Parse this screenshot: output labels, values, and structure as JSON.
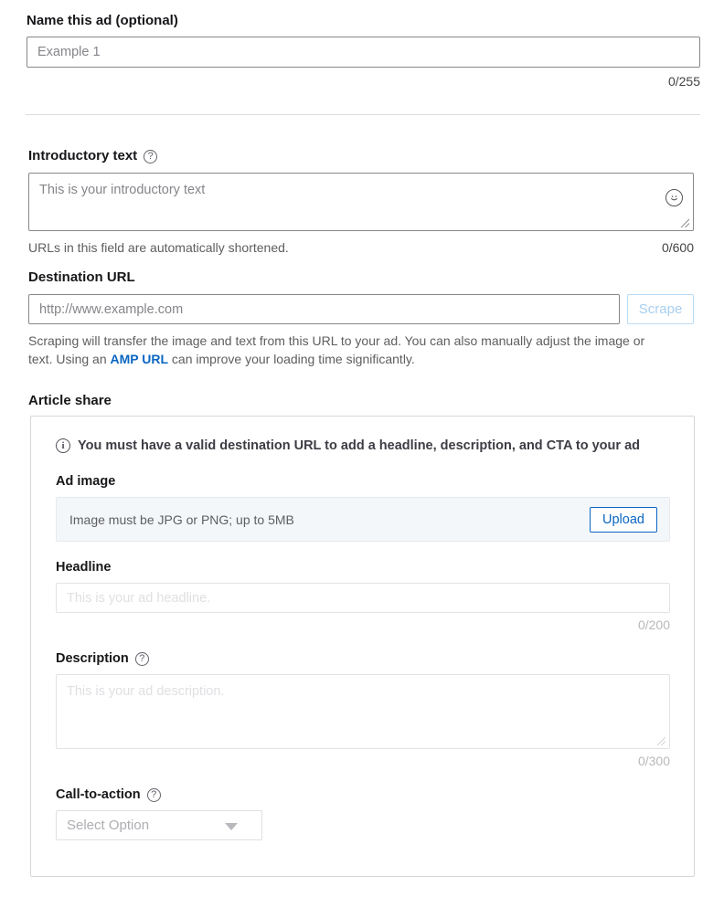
{
  "name_section": {
    "label": "Name this ad (optional)",
    "input_placeholder": "Example 1",
    "input_value": "",
    "counter": "0/255"
  },
  "intro_section": {
    "label": "Introductory text",
    "help_icon": "question-circle-icon",
    "textarea_placeholder": "This is your introductory text",
    "textarea_value": "",
    "emoji_icon": "smiley-face-icon",
    "helper": "URLs in this field are automatically shortened.",
    "counter": "0/600"
  },
  "destination_section": {
    "label": "Destination URL",
    "input_placeholder": "http://www.example.com",
    "input_value": "",
    "scrape_label": "Scrape",
    "helper_part1": "Scraping will transfer the image and text from this URL to your ad. You can also manually adjust the image or text. Using an ",
    "helper_link": "AMP URL",
    "helper_part2": " can improve your loading time significantly."
  },
  "article_share": {
    "label": "Article share",
    "notice_icon": "info-circle-icon",
    "notice": "You must have a valid destination URL to add a headline, description, and CTA to your ad",
    "ad_image": {
      "label": "Ad image",
      "hint": "Image must be JPG or PNG; up to 5MB",
      "upload_label": "Upload"
    },
    "headline": {
      "label": "Headline",
      "placeholder": "This is your ad headline.",
      "value": "",
      "counter": "0/200"
    },
    "description": {
      "label": "Description",
      "help_icon": "question-circle-icon",
      "placeholder": "This is your ad description.",
      "value": "",
      "counter": "0/300"
    },
    "cta": {
      "label": "Call-to-action",
      "help_icon": "question-circle-icon",
      "selected": "Select Option",
      "chevron_icon": "chevron-down-icon"
    }
  },
  "colors": {
    "link_blue": "#0a66c2",
    "disabled_blue": "#a8cff0",
    "text_primary": "#17171a",
    "text_helper": "#5e5e60",
    "upload_bg": "#f4f7f9"
  }
}
